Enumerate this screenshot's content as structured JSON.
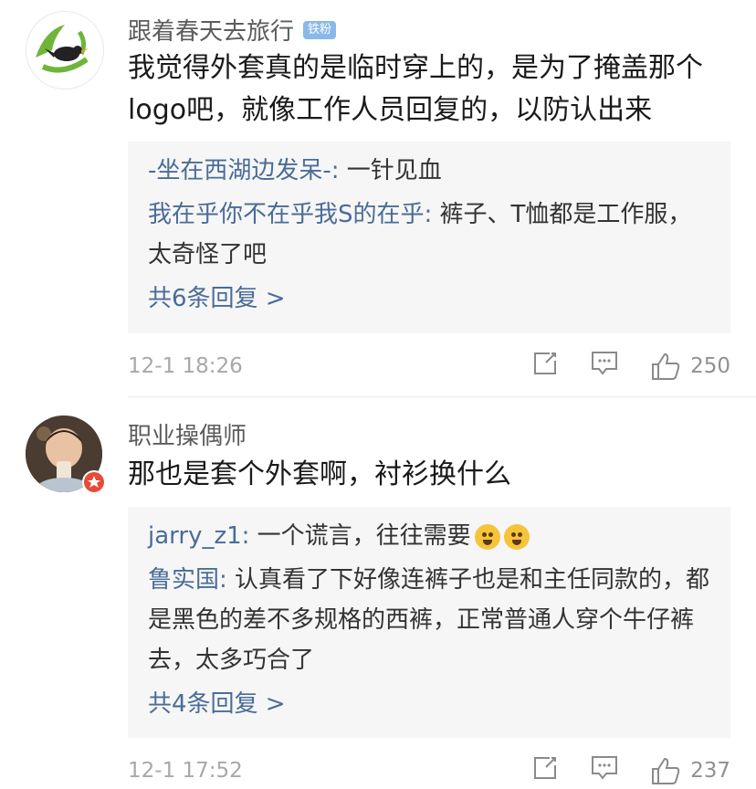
{
  "comments": [
    {
      "username": "跟着春天去旅行",
      "badge": "铁粉",
      "text": "我觉得外套真的是临时穿上的，是为了掩盖那个logo吧，就像工作人员回复的，以防认出来",
      "replies": [
        {
          "user": "-坐在西湖边发呆-:",
          "text": " 一针见血"
        },
        {
          "user": "我在乎你不在乎我S的在乎:",
          "text": " 裤子、T恤都是工作服，太奇怪了吧"
        }
      ],
      "more_label": "共6条回复 >",
      "time": "12-1 18:26",
      "likes": "250"
    },
    {
      "username": "职业操偶师",
      "text": "那也是套个外套啊，衬衫换什么",
      "replies": [
        {
          "user": "jarry_z1:",
          "text": " 一个谎言，往往需要"
        },
        {
          "user": "鲁实国:",
          "text": " 认真看了下好像连裤子也是和主任同款的，都是黑色的差不多规格的西裤，正常普通人穿个牛仔裤去，太多巧合了"
        }
      ],
      "more_label": "共4条回复 >",
      "time": "12-1 17:52",
      "likes": "237"
    }
  ],
  "icons": {
    "share": "share-icon",
    "comment": "comment-icon",
    "like": "thumbs-up-icon",
    "emoji": "blushing-smile-emoji"
  }
}
